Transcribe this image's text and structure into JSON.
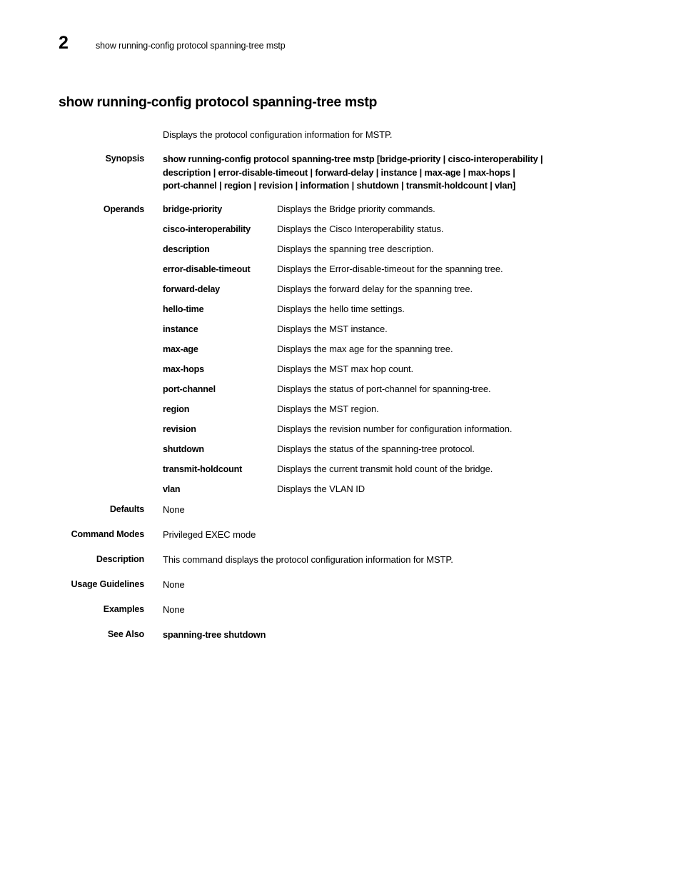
{
  "header": {
    "chapter_number": "2",
    "running_title": "show running-config protocol spanning-tree mstp"
  },
  "command": {
    "title": "show running-config protocol spanning-tree mstp",
    "intro": "Displays the protocol configuration information for MSTP."
  },
  "synopsis": {
    "label": "Synopsis",
    "lines": [
      "show running-config protocol spanning-tree mstp [bridge-priority | cisco-interoperability   |",
      "description | error-disable-timeout | forward-delay | instance | max-age | max-hops |",
      "port-channel | region | revision | information | shutdown | transmit-holdcount | vlan]"
    ]
  },
  "operands": {
    "label": "Operands",
    "items": [
      {
        "term": "bridge-priority",
        "desc": "Displays the Bridge priority commands."
      },
      {
        "term": "cisco-interoperability",
        "desc": "Displays the Cisco Interoperability status."
      },
      {
        "term": "description",
        "desc": "Displays the spanning tree description."
      },
      {
        "term": "error-disable-timeout",
        "desc": "Displays the Error-disable-timeout for the spanning tree."
      },
      {
        "term": "forward-delay",
        "desc": "Displays the forward delay for the spanning tree."
      },
      {
        "term": "hello-time",
        "desc": "Displays the hello time settings."
      },
      {
        "term": "instance",
        "desc": "Displays the MST instance."
      },
      {
        "term": "max-age",
        "desc": "Displays the max age for the spanning tree."
      },
      {
        "term": "max-hops",
        "desc": "Displays the MST max hop count."
      },
      {
        "term": "port-channel",
        "desc": "Displays the status of port-channel for spanning-tree."
      },
      {
        "term": "region",
        "desc": "Displays the MST region."
      },
      {
        "term": "revision",
        "desc": "Displays the revision number for configuration information."
      },
      {
        "term": "shutdown",
        "desc": "Displays the status of the spanning-tree protocol."
      },
      {
        "term": "transmit-holdcount",
        "desc": "Displays the current transmit hold count of the bridge."
      },
      {
        "term": "vlan",
        "desc": "Displays the VLAN ID"
      }
    ]
  },
  "sections": [
    {
      "label": "Defaults",
      "value": "None",
      "bold": false
    },
    {
      "label": "Command Modes",
      "value": "Privileged EXEC mode",
      "bold": false
    },
    {
      "label": "Description",
      "value": "This command displays the protocol configuration information for MSTP.",
      "bold": false
    },
    {
      "label": "Usage Guidelines",
      "value": "None",
      "bold": false
    },
    {
      "label": "Examples",
      "value": "None",
      "bold": false
    },
    {
      "label": "See Also",
      "value": "spanning-tree shutdown",
      "bold": true
    }
  ]
}
